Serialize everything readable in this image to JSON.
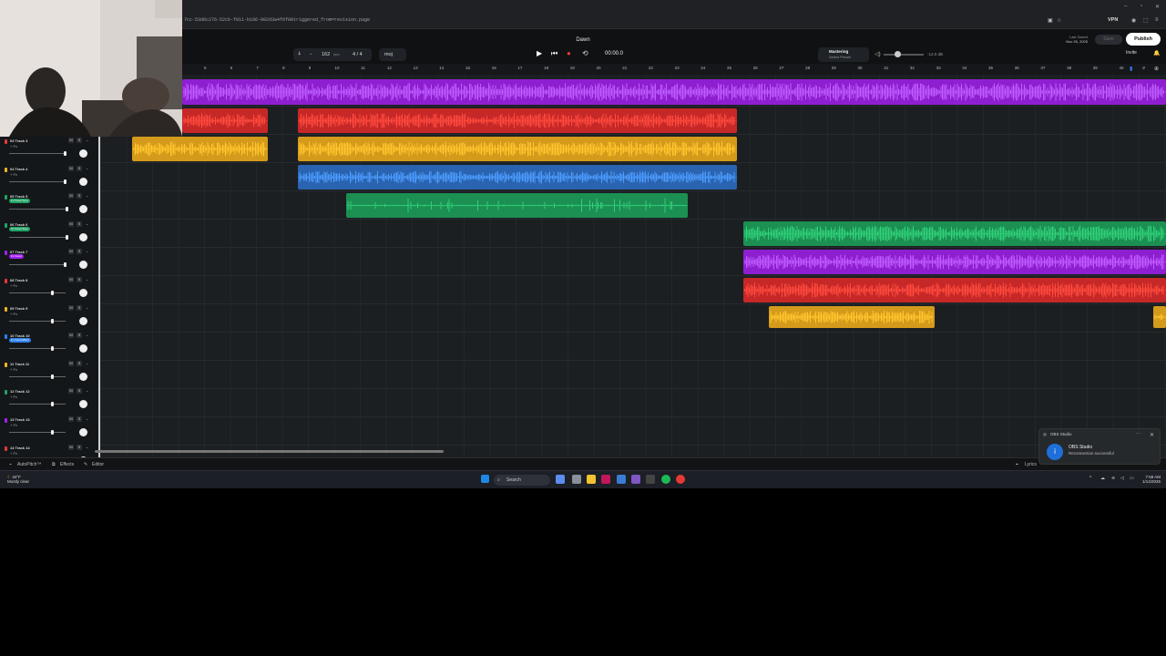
{
  "browser": {
    "url": "7cc-53d6c276-52cb-f011-b196-002d3a4f6f00triggered_from=revision.page",
    "vpn_label": "VPN"
  },
  "app": {
    "song_title": "Dawn",
    "tempo": "162",
    "tempo_unit": "bpm",
    "time_signature": "4 / 4",
    "key": "moj",
    "transport_time": "00:00.0",
    "mastering_title": "Mastering",
    "mastering_sub": "Select Preset",
    "volume_db": "-12.0 dB",
    "last_saved_label": "Last Saved",
    "last_saved_date": "Nov 26, 2025",
    "save_label": "Save",
    "publish_label": "Publish",
    "invite_label": "Invite"
  },
  "ruler_ticks": [
    "5",
    "6",
    "7",
    "8",
    "9",
    "10",
    "11",
    "12",
    "13",
    "14",
    "15",
    "16",
    "17",
    "18",
    "19",
    "20",
    "21",
    "22",
    "23",
    "24",
    "25",
    "26",
    "27",
    "28",
    "29",
    "30",
    "31",
    "32",
    "33",
    "34",
    "35",
    "36",
    "37",
    "38",
    "39",
    "40"
  ],
  "tracks": [
    {
      "name": "03  Track 3",
      "fx": "+ Fx",
      "color": "#e53935",
      "tag": ""
    },
    {
      "name": "04  Track 4",
      "fx": "+ Fx",
      "color": "#f0b429",
      "tag": ""
    },
    {
      "name": "05  Track 5",
      "fx": "",
      "color": "#1fa463",
      "tag": "Fx  Vocal Tone"
    },
    {
      "name": "06  Track 6",
      "fx": "",
      "color": "#1fa463",
      "tag": "Fx  Vocal Tone"
    },
    {
      "name": "07  Track 7",
      "fx": "",
      "color": "#a020f0",
      "tag": "Fx  Vocal"
    },
    {
      "name": "08  Track 8",
      "fx": "+ Fx",
      "color": "#e53935",
      "tag": ""
    },
    {
      "name": "09  Track 9",
      "fx": "+ Fx",
      "color": "#f0b429",
      "tag": ""
    },
    {
      "name": "10  Track 10",
      "fx": "",
      "color": "#2f80ed",
      "tag": "Fx  Vocal Effect"
    },
    {
      "name": "11  Track 11",
      "fx": "+ Fx",
      "color": "#f0b429",
      "tag": ""
    },
    {
      "name": "12  Track 12",
      "fx": "+ Fx",
      "color": "#1fa463",
      "tag": ""
    },
    {
      "name": "13  Track 13",
      "fx": "+ Fx",
      "color": "#a020f0",
      "tag": ""
    },
    {
      "name": "14  Track 14",
      "fx": "+ Fx",
      "color": "#e53935",
      "tag": ""
    }
  ],
  "mute_label": "M",
  "solo_label": "S",
  "bottom_bar": {
    "autopitch": "AutoPitch™",
    "effects": "Effects",
    "editor": "Editor",
    "lyrics": "Lyrics"
  },
  "toast": {
    "app": "OBS Studio",
    "title": "OBS Studio",
    "message": "Reconnection successful"
  },
  "taskbar": {
    "weather_temp": "34°F",
    "weather_desc": "Mostly clear",
    "search_placeholder": "Search",
    "time": "7:58 AM",
    "date": "1/14/2026"
  },
  "colors": {
    "purple": "#a020f0",
    "red": "#d32f2f",
    "yellow": "#e7a923",
    "blue": "#2f6fc0",
    "green": "#1f9a5a"
  }
}
